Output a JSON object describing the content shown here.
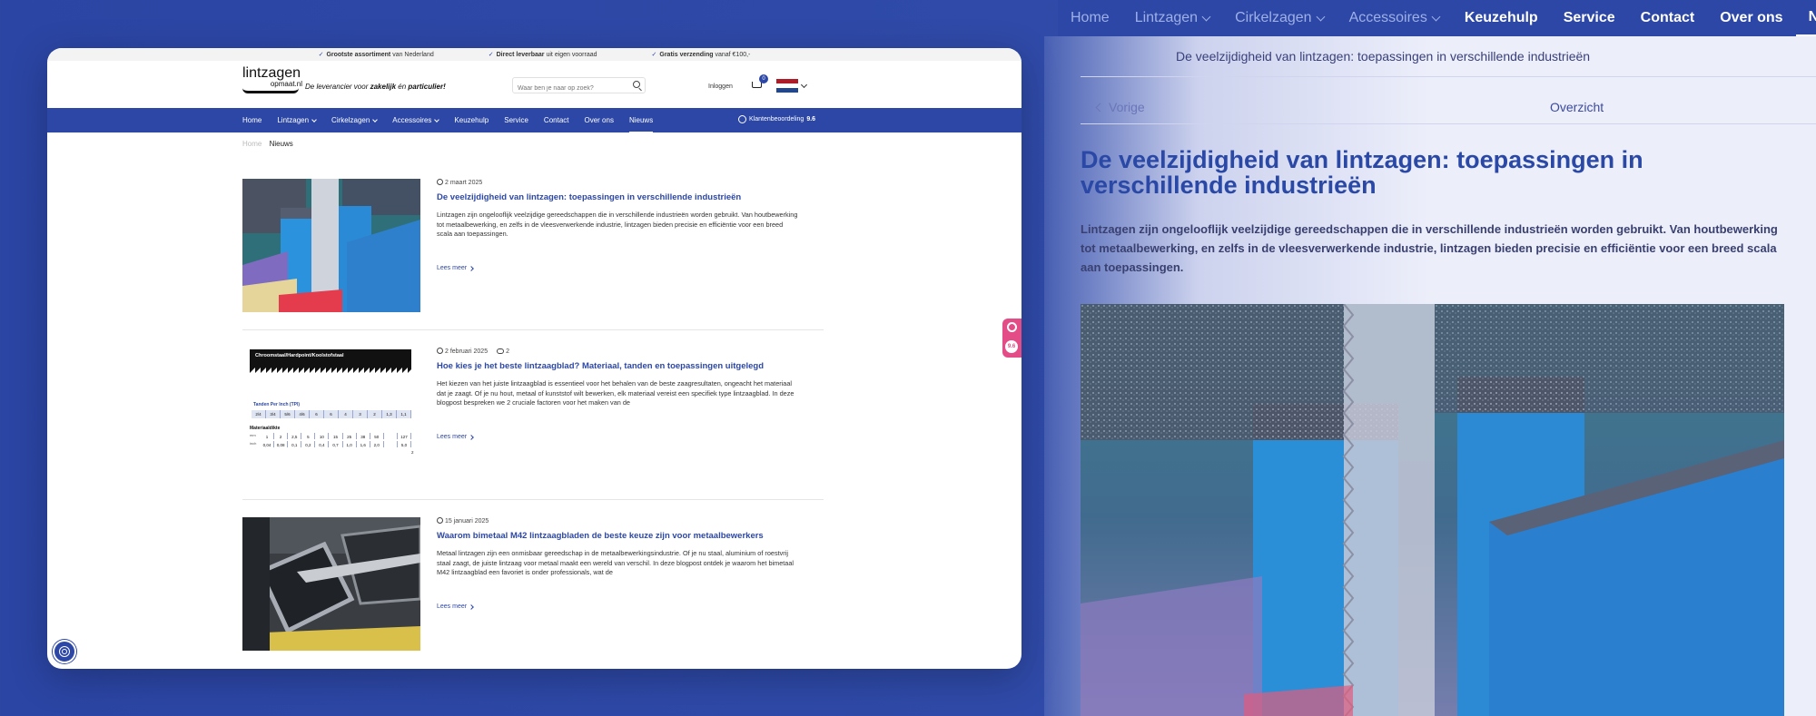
{
  "colors": {
    "brand_blue": "#2c47a6",
    "accent_pink": "#e34c86"
  },
  "background_page": {
    "nav": [
      {
        "label": "Home",
        "dim": true,
        "chevron": false
      },
      {
        "label": "Lintzagen",
        "dim": true,
        "chevron": true
      },
      {
        "label": "Cirkelzagen",
        "dim": true,
        "chevron": true
      },
      {
        "label": "Accessoires",
        "dim": true,
        "chevron": true
      },
      {
        "label": "Keuzehulp",
        "dim": false,
        "chevron": false
      },
      {
        "label": "Service",
        "dim": false,
        "chevron": false
      },
      {
        "label": "Contact",
        "dim": false,
        "chevron": false
      },
      {
        "label": "Over ons",
        "dim": false,
        "chevron": false
      },
      {
        "label": "Nieuws",
        "dim": false,
        "chevron": false,
        "active": true
      }
    ],
    "breadcrumb": "De veelzijdigheid van lintzagen: toepassingen in verschillende industrieën",
    "prev_label": "Vorige",
    "overview_label": "Overzicht",
    "title": "De veelzijdigheid van lintzagen: toepassingen in verschillende industrieën",
    "lead": "Lintzagen zijn ongelooflijk veelzijdige gereedschappen die in verschillende industrieën worden gebruikt. Van houtbewerking tot metaalbewerking, en zelfs in de vleesverwerkende industrie, lintzagen bieden precisie en efficiëntie voor een breed scala aan toepassingen."
  },
  "site": {
    "usps": [
      {
        "bold": "Grootste assortiment",
        "rest": " van Nederland"
      },
      {
        "bold": "Direct leverbaar",
        "rest": " uit eigen voorraad"
      },
      {
        "bold": "Gratis verzending",
        "rest": " vanaf €100,-"
      }
    ],
    "logo_line1": "lintzagen",
    "logo_line2": "opmaat.nl",
    "tagline_pre": "De leverancier voor ",
    "tagline_b1": "zakelijk",
    "tagline_mid": " én ",
    "tagline_b2": "particulier!",
    "search_placeholder": "Waar ben je naar op zoek?",
    "login_label": "Inloggen",
    "cart_count": "0",
    "nav": [
      {
        "label": "Home",
        "chevron": false
      },
      {
        "label": "Lintzagen",
        "chevron": true
      },
      {
        "label": "Cirkelzagen",
        "chevron": true
      },
      {
        "label": "Accessoires",
        "chevron": true
      },
      {
        "label": "Keuzehulp",
        "chevron": false
      },
      {
        "label": "Service",
        "chevron": false
      },
      {
        "label": "Contact",
        "chevron": false
      },
      {
        "label": "Over ons",
        "chevron": false
      },
      {
        "label": "Nieuws",
        "chevron": false,
        "active": true
      }
    ],
    "rating_label": "Klantenbeoordeling",
    "rating_value": "9.6",
    "breadcrumb_home": "Home",
    "breadcrumb_current": "Nieuws",
    "articles": [
      {
        "date": "2 maart 2025",
        "comments": "",
        "title": "De veelzijdigheid van lintzagen: toepassingen in verschillende industrieën",
        "excerpt": "Lintzagen zijn ongelooflijk veelzijdige gereedschappen die in verschillende industrieën worden gebruikt. Van houtbewerking tot metaalbewerking, en zelfs in de vleesverwerkende industrie, lintzagen bieden precisie en efficiëntie voor een breed scala aan toepassingen.",
        "more": "Lees meer"
      },
      {
        "date": "2 februari 2025",
        "comments": "2",
        "title": "Hoe kies je het beste lintzaagblad? Materiaal, tanden en toepassingen uitgelegd",
        "excerpt": "Het kiezen van het juiste lintzaagblad is essentieel voor het behalen van de beste zaagresultaten, ongeacht het materiaal dat je zaagt. Of je nu hout, metaal of kunststof wilt bewerken, elk materiaal vereist een specifiek type lintzaagblad. In deze blogpost bespreken we 2 cruciale factoren voor het maken van de",
        "more": "Lees meer"
      },
      {
        "date": "15 januari 2025",
        "comments": "",
        "title": "Waarom bimetaal M42 lintzaagbladen de beste keuze zijn voor metaalbewerkers",
        "excerpt": "Metaal lintzagen zijn een onmisbaar gereedschap in de metaalbewerkingsindustrie. Of je nu staal, aluminium of roestvrij staal zaagt, de juiste lintzaag voor metaal maakt een wereld van verschil. In deze blogpost ontdek je waarom het bimetaal M42 lintzaagblad een favoriet is onder professionals, wat de",
        "more": "Lees meer"
      }
    ],
    "tpi_chart": {
      "header": "Chroomstaal/Hardpoint/Koolstofstaal",
      "tpi_label": "Tanden Per Inch (TPI)",
      "tpi_values": [
        "2/4",
        "3/4",
        "5/6",
        "4/6",
        "6",
        "6",
        "4",
        "3",
        "2",
        "1,3",
        "1,1"
      ],
      "material_label": "Materiaaldikte",
      "row1_label": "mm",
      "row1": [
        "1",
        "2",
        "2,5",
        "5",
        "10",
        "15",
        "25",
        "38",
        "50",
        "",
        "127"
      ],
      "row2_label": "inch",
      "row2": [
        "0,04",
        "0,08",
        "0,1",
        "0,2",
        "0,4",
        "0,7",
        "1,0",
        "1,6",
        "2,0",
        "",
        "5,0"
      ],
      "end_mark": "2"
    },
    "widget_score": "9.6"
  }
}
